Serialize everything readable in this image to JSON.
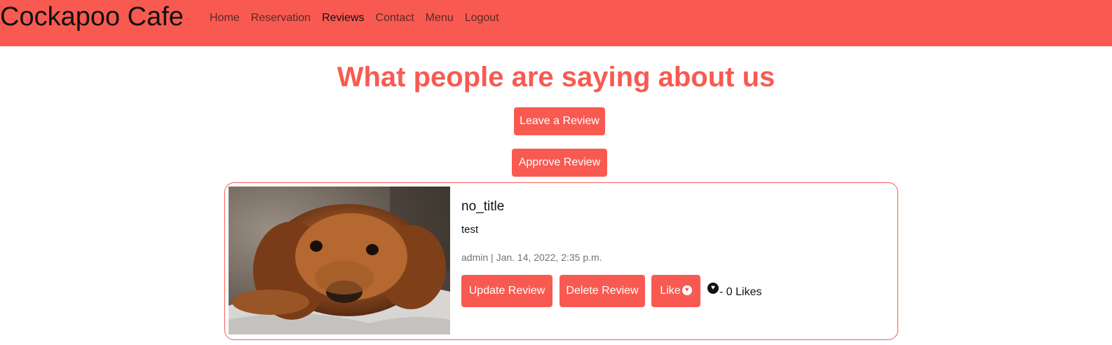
{
  "navbar": {
    "brand": "Cockapoo Cafe",
    "links": [
      "Home",
      "Reservation",
      "Reviews",
      "Contact",
      "Menu",
      "Logout"
    ],
    "active": "Reviews",
    "background": "#f85a51"
  },
  "page": {
    "heading": "What people are saying about us",
    "leave_review_label": "Leave a Review",
    "approve_review_label": "Approve Review"
  },
  "review": {
    "image_alt": "cockapoo-dog-photo",
    "title": "no_title",
    "body": "test",
    "author": "admin",
    "separator": "|",
    "date": "Jan. 14, 2022, 2:35 p.m.",
    "update_label": "Update Review",
    "delete_label": "Delete Review",
    "like_label": "Like",
    "likes_text": "- 0 Likes"
  },
  "icons": {
    "like_button_icon": "heart-icon",
    "likes_count_icon": "heart-icon"
  },
  "colors": {
    "accent": "#f85a51",
    "text": "#111111",
    "muted": "#6c757d"
  }
}
